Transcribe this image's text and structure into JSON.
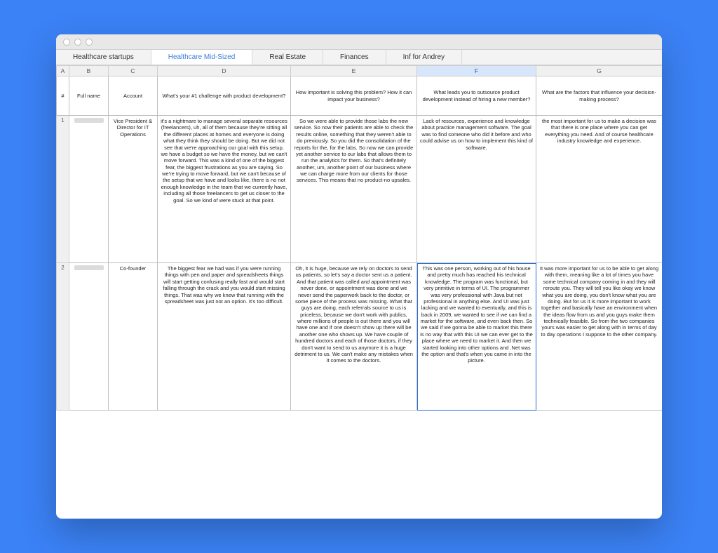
{
  "tabs": [
    {
      "label": "Healthcare startups",
      "active": false
    },
    {
      "label": "Healthcare Mid-Sized",
      "active": true
    },
    {
      "label": "Real Estate",
      "active": false
    },
    {
      "label": "Finances",
      "active": false
    },
    {
      "label": "Inf for Andrey",
      "active": false
    }
  ],
  "columns": [
    "A",
    "B",
    "C",
    "D",
    "E",
    "F",
    "G"
  ],
  "selected_col": "F",
  "headers": {
    "num": "#",
    "fullname": "Full name",
    "account": "Account",
    "q1": "What's your #1 challenge with product development?",
    "q2": "How important is solving this problem? How it can impact your business?",
    "q3": "What leads you to outsource product development instead of hiring a new member?",
    "q4": "What are the factors that influence your decision-making process?"
  },
  "rows": [
    {
      "n": "1",
      "account": "Vice President & Director for IT Operations",
      "q1": "it's a nightmare to manage several separate resources (freelancers), uh, all of them because they're sitting all the different places at homes and everyone is doing what they think they should be doing. But we did not see that we're approaching our goal with this setup. we have a budget so we have the money, but we can't move forward. This was a kind of one of the biggest fear, the biggest frustrations as you are saying. So we're trying to move forward, but we can't because of the setup that we have and looks like, there is no not enough knowledge in the team that we currently have, including all those freelancers to get us closer to the goal. So we kind of were stuck at that point.",
      "q2": "So we were able to provide those labs the new service. So now their patients are able to check the results online, something that they weren't able to do previously. So you did the consolidation of the reports for the, for the labs. So now we can provide yet another service to our labs that allows them to run the analytics for them. So that's definitely another, um, another point of our business where we can charge more from our clients for those services. This means that no product-no upsales.",
      "q3": "Lack of resources, experience and knowledge about practice management software. The goal was to find someone who did it before and who could advise us on how to implement this kind of software.",
      "q4": "the most important for us to make a decision was that there is one place where you can get everything you need. And of course healthcare industry knowledge and experience."
    },
    {
      "n": "2",
      "account": "Co-founder",
      "q1": "The biggest fear we had was if you were running things with pen and paper and spreadsheets things will start getting confusing really fast and would start falling through the crack and you would start missing things. That was why we knew that running with the spreadsheet was just not an option. It's too difficult.",
      "q2": "Oh, it is huge, because we rely on doctors to send us patients, so let's say a doctor sent us a patient. And that patient was called and appointment was never done, or appointment was done and we never send the paperwork back to the doctor, or some piece of the process was missing. What that guys are doing, each referrals source to us is priceless, because we don't work with publics, where millions of people is out there and you will have one and if one doesn't show up there will be another one who shows up. We have couple of hundred doctors and each of those doctors, if they don't want to send to us anymore it is a huge detriment to us. We can't make any mistakes when it comes to the doctors.",
      "q3": "This was one person, working out of his house and pretty much has reached his technical knowledge. The program was functional, but very primitive in terms of UI. The programmer was very professional with Java but not professional in anything else. And UI was just lacking and we wanted to eventually, and this is back in 2009, we wanted to see if we can find a market for the software, and even back then. So we said if we gonna be able to market this there is no way that with this UI we can ever get to the place where we need to market it. And then we started looking into other options and .Net was the option and that's when you came in into the picture.",
      "q4": "It was more important for us to be able to get along with them, meaning like a lot of times you have some technical company coming in and they will reroute you. They will tell you like okay we know what you are doing, you don't know what you are doing. But for us it is more important to work together and basically have an environment when the ideas flow from us and you guys make them technically feasible. So from the two companies yours was easier to get along with in terms of day to day operations I suppose to the other company."
    }
  ]
}
